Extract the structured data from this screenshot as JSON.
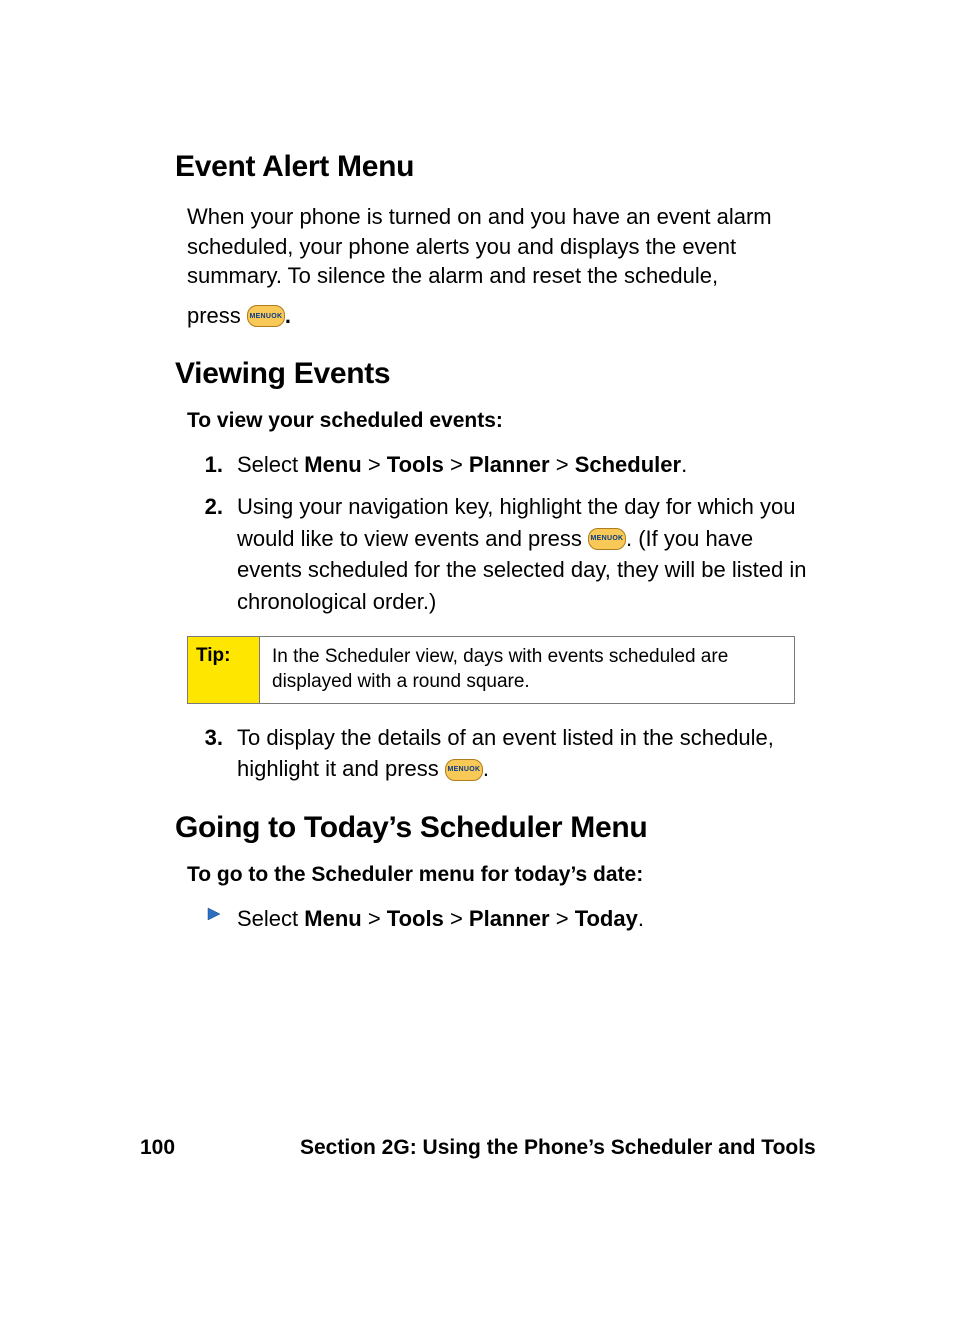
{
  "section1": {
    "heading": "Event Alert Menu",
    "para1": "When your phone is turned on and you have an event alarm scheduled, your phone alerts you and displays the event summary. To silence the alarm and reset the schedule,",
    "para2_pre": "press ",
    "para2_post": "."
  },
  "key": {
    "top": "MENU",
    "bot": "OK"
  },
  "section2": {
    "heading": "Viewing Events",
    "sub": "To view your scheduled events:",
    "steps": {
      "s1": {
        "num": "1.",
        "pre": "Select ",
        "b1": "Menu",
        "gt1": " > ",
        "b2": "Tools",
        "gt2": " > ",
        "b3": "Planner",
        "gt3": " > ",
        "b4": "Scheduler",
        "post": "."
      },
      "s2": {
        "num": "2.",
        "line1": "Using your navigation key, highlight the day for which",
        "line2_pre": "you would like to view events and press ",
        "line2_post": ". (If you have events scheduled for the selected day, they will be listed in chronological order.)"
      },
      "tip": {
        "label": "Tip:",
        "body": "In the Scheduler view, days with events scheduled are displayed with a round square."
      },
      "s3": {
        "num": "3.",
        "line1": "To display the details of an event listed in the schedule,",
        "line2_pre": "highlight it and press ",
        "line2_post": "."
      }
    }
  },
  "section3": {
    "heading": "Going to Today’s Scheduler Menu",
    "sub": "To go to the Scheduler menu for today’s date:",
    "bullet": {
      "pre": "Select ",
      "b1": "Menu",
      "gt1": " > ",
      "b2": "Tools",
      "gt2": " > ",
      "b3": "Planner",
      "gt3": " > ",
      "b4": "Today",
      "post": "."
    }
  },
  "footer": {
    "page": "100",
    "text": "Section 2G: Using the Phone’s Scheduler and Tools"
  }
}
